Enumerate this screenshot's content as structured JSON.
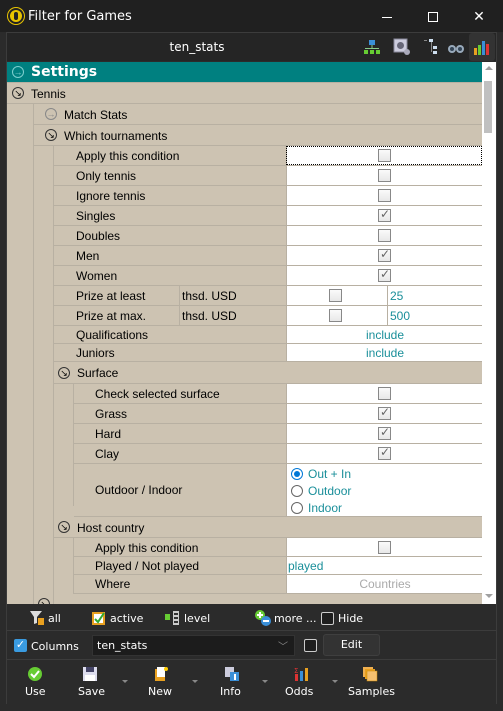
{
  "window": {
    "title": "Filter for Games"
  },
  "header": {
    "name": "ten_stats",
    "icons": [
      "network-icon",
      "settings-panel-icon",
      "tree-icon",
      "binoculars-icon",
      "bar-chart-icon"
    ]
  },
  "grid": {
    "section": "Settings",
    "group": "Tennis",
    "match_stats": "Match Stats",
    "which_tournaments": "Which tournaments",
    "rows": {
      "apply": "Apply this condition",
      "only_tennis": "Only tennis",
      "ignore_tennis": "Ignore tennis",
      "singles": "Singles",
      "doubles": "Doubles",
      "men": "Men",
      "women": "Women",
      "prize_least": "Prize at least",
      "prize_max": "Prize at max.",
      "prize_unit": "thsd. USD",
      "prize_least_value": "25",
      "prize_max_value": "500",
      "qualifications": "Qualifications",
      "qualifications_value": "include",
      "juniors": "Juniors",
      "juniors_value": "include"
    },
    "checks": {
      "apply": false,
      "only_tennis": false,
      "ignore_tennis": false,
      "singles": true,
      "doubles": false,
      "men": true,
      "women": true,
      "prize_least": false,
      "prize_max": false
    },
    "surface": {
      "label": "Surface",
      "check_selected": "Check selected surface",
      "grass": "Grass",
      "hard": "Hard",
      "clay": "Clay",
      "outdoor_indoor": "Outdoor / Indoor",
      "options": [
        "Out + In",
        "Outdoor",
        "Indoor"
      ],
      "selected": "Out + In",
      "checks": {
        "check_selected": false,
        "grass": true,
        "hard": true,
        "clay": true
      }
    },
    "host": {
      "label": "Host country",
      "apply": "Apply this condition",
      "played": "Played / Not played",
      "played_value": "played",
      "where": "Where",
      "where_value": "Countries",
      "apply_checked": false
    }
  },
  "bar1": {
    "all": "all",
    "active": "active",
    "level": "level",
    "more": "more ...",
    "hide": "Hide"
  },
  "bar2": {
    "columns": "Columns",
    "columns_checked": true,
    "combo_value": "ten_stats",
    "edit": "Edit"
  },
  "toolbar": {
    "use": "Use",
    "save": "Save",
    "new": "New",
    "info": "Info",
    "odds": "Odds",
    "samples": "Samples"
  },
  "colors": {
    "section": "#008080",
    "grid_bg": "#cdc3b2",
    "link": "#1a8f9a",
    "radio": "#0078d7"
  }
}
